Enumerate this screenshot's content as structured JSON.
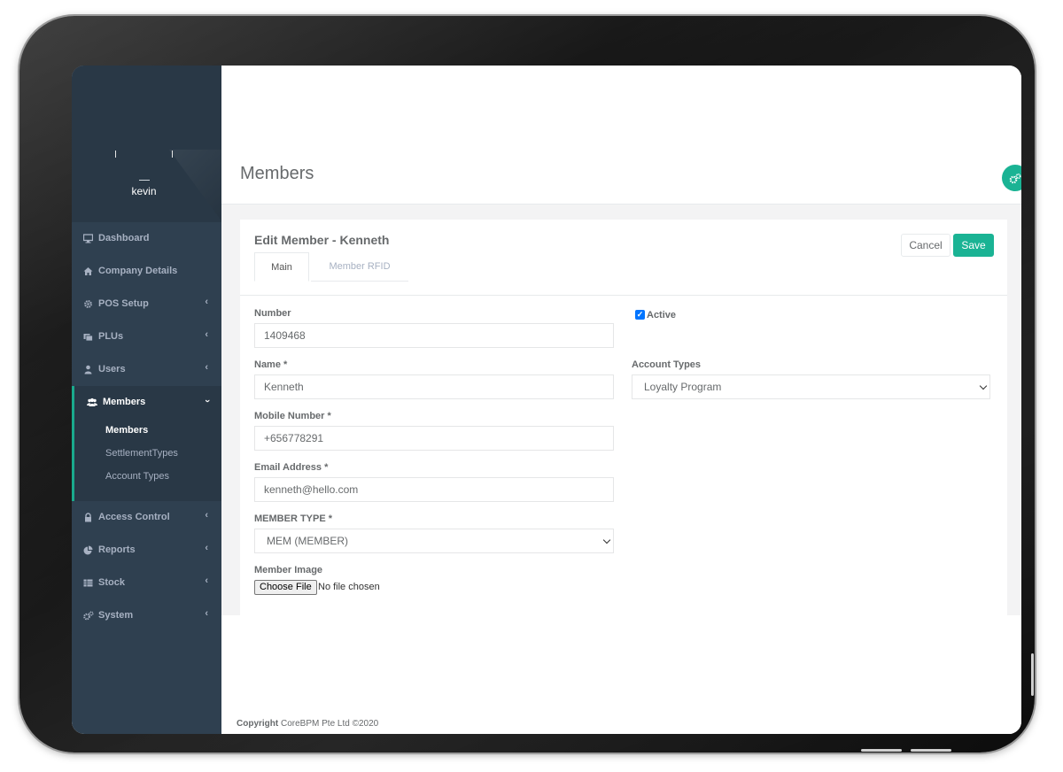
{
  "user": {
    "name": "kevin"
  },
  "sidebar": {
    "items": [
      {
        "label": "Dashboard",
        "icon": "desktop-icon"
      },
      {
        "label": "Company Details",
        "icon": "home-icon"
      },
      {
        "label": "POS Setup",
        "icon": "gear-icon"
      },
      {
        "label": "PLUs",
        "icon": "folders-icon"
      },
      {
        "label": "Users",
        "icon": "user-icon"
      },
      {
        "label": "Members",
        "icon": "users-icon",
        "expanded": true,
        "children": [
          "Members",
          "SettlementTypes",
          "Account Types"
        ]
      },
      {
        "label": "Access Control",
        "icon": "lock-icon"
      },
      {
        "label": "Reports",
        "icon": "pie-chart-icon"
      },
      {
        "label": "Stock",
        "icon": "table-icon"
      },
      {
        "label": "System",
        "icon": "cogs-icon"
      }
    ]
  },
  "header": {
    "title": "Members"
  },
  "panel": {
    "title": "Edit Member - Kenneth",
    "cancel_label": "Cancel",
    "save_label": "Save",
    "tabs": [
      "Main",
      "Member RFID"
    ]
  },
  "form": {
    "number": {
      "label": "Number",
      "value": "1409468"
    },
    "name": {
      "label": "Name *",
      "value": "Kenneth"
    },
    "mobile": {
      "label": "Mobile Number *",
      "value": "+656778291"
    },
    "email": {
      "label": "Email Address *",
      "value": "kenneth@hello.com"
    },
    "member_type": {
      "label": "MEMBER TYPE *",
      "value": "MEM (MEMBER)"
    },
    "member_image": {
      "label": "Member Image",
      "button": "Choose File",
      "status": "No file chosen"
    },
    "active": {
      "label": "Active",
      "checked": true
    },
    "account_types": {
      "label": "Account Types",
      "value": "Loyalty Program"
    }
  },
  "footer": {
    "copyright_label": "Copyright",
    "copyright_text": "CoreBPM Pte Ltd ©2020"
  },
  "colors": {
    "sidebar": "#2f4050",
    "accent": "#1ab394",
    "page_bg": "#f3f3f4"
  }
}
